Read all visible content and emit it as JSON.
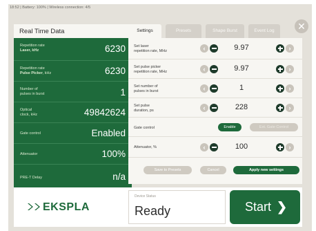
{
  "statusbar": "18:52  |  Battery: 100%  |  Wireless connection: 4/5",
  "left_panel": {
    "title": "Real Time Data",
    "rows": [
      {
        "label1": "Repetition rate",
        "label2": "Laser, kHz",
        "value": "6230"
      },
      {
        "label1": "Repetition rate",
        "label2": "Pulse Picker, kHz",
        "value": "6230"
      },
      {
        "label1": "Number of",
        "label2": "pulses in burst",
        "value": "1"
      },
      {
        "label1": "Optical",
        "label2": "clock, kHz",
        "value": "49842624"
      },
      {
        "label1": "Gate control",
        "label2": "",
        "value": "Enabled"
      },
      {
        "label1": "Attenuator",
        "label2": "",
        "value": "100%"
      },
      {
        "label1": "PRE-T Delay",
        "label2": "",
        "value": "n/a"
      }
    ]
  },
  "tabs": [
    "Settings",
    "Presets",
    "Shape Burst",
    "Event Log"
  ],
  "settings": {
    "rows": [
      {
        "label1": "Set laser",
        "label2": "repetition rate, MHz",
        "value": "9.97"
      },
      {
        "label1": "Set pulse picker",
        "label2": "repetition rate, MHz",
        "value": "9.97"
      },
      {
        "label1": "Set number of",
        "label2": "pulses in burst",
        "value": "1"
      },
      {
        "label1": "Set pulse",
        "label2": "duration, ps",
        "value": "228"
      }
    ],
    "gate": {
      "label": "Gate control",
      "enable": "Enable",
      "other": "Ext. Gate Control"
    },
    "attenuator": {
      "label": "Attenuator, %",
      "value": "100"
    },
    "buttons": {
      "save": "Save to Presets",
      "cancel": "Cancel",
      "apply": "Apply new settings"
    }
  },
  "bottom": {
    "logo": "EKSPLA",
    "status_caption": "Device Status",
    "status_value": "Ready",
    "start": "Start"
  },
  "colors": {
    "brand_green": "#1e6a3b",
    "dark_control": "#1e3b2b",
    "background": "#e4e1da"
  }
}
